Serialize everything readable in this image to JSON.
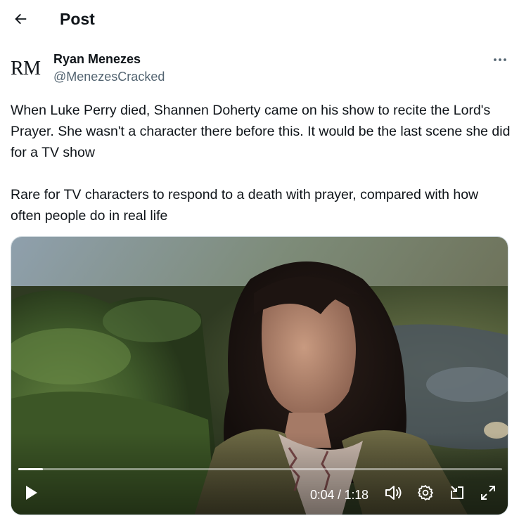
{
  "header": {
    "back_icon": "arrow-left-icon",
    "title": "Post"
  },
  "post": {
    "avatar_text": "RM",
    "author_name": "Ryan Menezes",
    "author_handle": "@MenezesCracked",
    "more_icon": "more-horizontal-icon",
    "paragraphs": [
      "When Luke Perry died, Shannen Doherty came on his show to recite the Lord's Prayer. She wasn't a character there before this. It would be the last scene she did for a TV show",
      "Rare for TV characters to respond to a death with prayer, compared with how often people do in real life"
    ]
  },
  "video": {
    "current_time": "0:04",
    "separator": "/",
    "duration": "1:18",
    "time_text": "0:04 / 1:18",
    "progress": 0.051,
    "controls": {
      "play_icon": "play-icon",
      "volume_icon": "volume-icon",
      "settings_icon": "gear-icon",
      "minimize_icon": "picture-in-picture-icon",
      "fullscreen_icon": "fullscreen-icon"
    }
  },
  "colors": {
    "text_primary": "#0f1419",
    "text_secondary": "#536471",
    "border": "#cfd9de"
  }
}
